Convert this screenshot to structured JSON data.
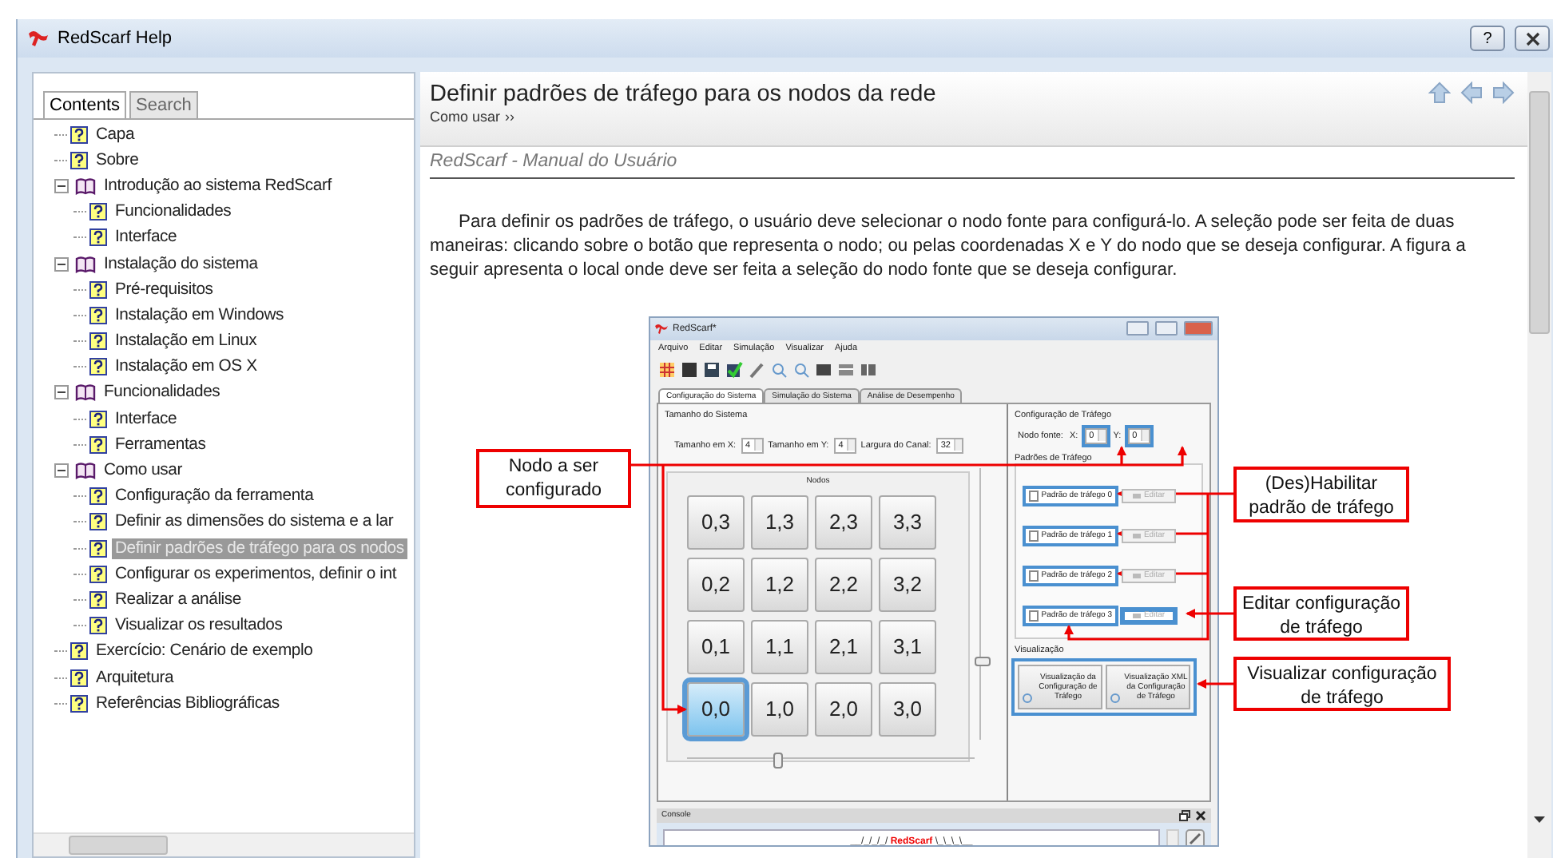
{
  "window": {
    "title": "RedScarf Help",
    "help_label": "?"
  },
  "nav_tabs": [
    {
      "label": "Contents",
      "selected": true
    },
    {
      "label": "Search",
      "selected": false
    }
  ],
  "tree": [
    {
      "label": "Capa",
      "kind": "page",
      "selected": false
    },
    {
      "label": "Sobre",
      "kind": "page",
      "selected": false
    },
    {
      "label": "Introdução ao sistema RedScarf",
      "kind": "book",
      "expanded": true,
      "selected": false,
      "children": [
        {
          "label": "Funcionalidades",
          "kind": "page",
          "selected": false
        },
        {
          "label": "Interface",
          "kind": "page",
          "selected": false
        }
      ]
    },
    {
      "label": "Instalação do sistema",
      "kind": "book",
      "expanded": true,
      "selected": false,
      "children": [
        {
          "label": "Pré-requisitos",
          "kind": "page",
          "selected": false
        },
        {
          "label": "Instalação em Windows",
          "kind": "page",
          "selected": false
        },
        {
          "label": "Instalação em Linux",
          "kind": "page",
          "selected": false
        },
        {
          "label": "Instalação em OS X",
          "kind": "page",
          "selected": false
        }
      ]
    },
    {
      "label": "Funcionalidades",
      "kind": "book",
      "expanded": true,
      "selected": false,
      "children": [
        {
          "label": "Interface",
          "kind": "page",
          "selected": false
        },
        {
          "label": "Ferramentas",
          "kind": "page",
          "selected": false
        }
      ]
    },
    {
      "label": "Como usar",
      "kind": "book",
      "expanded": true,
      "selected": false,
      "children": [
        {
          "label": "Configuração da ferramenta",
          "kind": "page",
          "selected": false
        },
        {
          "label": "Definir as dimensões do sistema e a lar",
          "kind": "page",
          "selected": false
        },
        {
          "label": "Definir padrões de tráfego para os nodos",
          "kind": "page",
          "selected": true
        },
        {
          "label": "Configurar os experimentos, definir o int",
          "kind": "page",
          "selected": false
        },
        {
          "label": "Realizar a análise",
          "kind": "page",
          "selected": false
        },
        {
          "label": "Visualizar os resultados",
          "kind": "page",
          "selected": false
        }
      ]
    },
    {
      "label": "Exercício: Cenário de exemplo",
      "kind": "page",
      "selected": false
    },
    {
      "label": "Arquitetura",
      "kind": "page",
      "selected": false
    },
    {
      "label": "Referências Bibliográficas",
      "kind": "page",
      "selected": false
    }
  ],
  "topic": {
    "title": "Definir padrões de tráfego para os nodos da rede",
    "breadcrumb": "Como usar",
    "breadcrumb_sep": "››"
  },
  "doc_header": "RedScarf - Manual do Usuário",
  "paragraph": "Para definir os padrões de tráfego, o usuário deve selecionar o nodo fonte para configurá-lo. A seleção pode ser feita de duas maneiras: clicando sobre o botão que representa o nodo; ou pelas coordenadas X e Y do nodo que se deseja configurar. A figura a seguir apresenta o local onde deve ser feita a seleção do nodo fonte que se deseja configurar.",
  "figure": {
    "window": {
      "title": "RedScarf*"
    },
    "menu": [
      "Arquivo",
      "Editar",
      "Simulação",
      "Visualizar",
      "Ajuda"
    ],
    "tabs": [
      {
        "label": "Configuração do Sistema",
        "selected": true
      },
      {
        "label": "Simulação do Sistema",
        "selected": false
      },
      {
        "label": "Análise de Desempenho",
        "selected": false
      }
    ],
    "size_group": {
      "title": "Tamanho do Sistema",
      "fields": [
        {
          "label": "Tamanho em X:",
          "value": "4"
        },
        {
          "label": "Tamanho em Y:",
          "value": "4"
        },
        {
          "label": "Largura do Canal:",
          "value": "32"
        }
      ]
    },
    "nodes": {
      "title": "Nodos",
      "rows": [
        [
          {
            "label": "0,3",
            "selected": false
          },
          {
            "label": "1,3",
            "selected": false
          },
          {
            "label": "2,3",
            "selected": false
          },
          {
            "label": "3,3",
            "selected": false
          }
        ],
        [
          {
            "label": "0,2",
            "selected": false
          },
          {
            "label": "1,2",
            "selected": false
          },
          {
            "label": "2,2",
            "selected": false
          },
          {
            "label": "3,2",
            "selected": false
          }
        ],
        [
          {
            "label": "0,1",
            "selected": false
          },
          {
            "label": "1,1",
            "selected": false
          },
          {
            "label": "2,1",
            "selected": false
          },
          {
            "label": "3,1",
            "selected": false
          }
        ],
        [
          {
            "label": "0,0",
            "selected": true
          },
          {
            "label": "1,0",
            "selected": false
          },
          {
            "label": "2,0",
            "selected": false
          },
          {
            "label": "3,0",
            "selected": false
          }
        ]
      ]
    },
    "sliders": {
      "vertical": {
        "level": 0.27
      },
      "horizontal": {
        "level": 0.3
      }
    },
    "traffic": {
      "title": "Configuração de Tráfego",
      "source_label": "Nodo fonte:",
      "coords": [
        {
          "label": "X:",
          "value": "0",
          "highlighted": true
        },
        {
          "label": "Y:",
          "value": "0",
          "highlighted": true
        }
      ]
    },
    "patterns": {
      "title": "Padrões de Tráfego",
      "items": [
        {
          "label": "Padrão de tráfego 0",
          "checked": false,
          "highlighted": true,
          "edit_label": "Editar",
          "edit_disabled": true,
          "edit_highlighted": false
        },
        {
          "label": "Padrão de tráfego 1",
          "checked": false,
          "highlighted": true,
          "edit_label": "Editar",
          "edit_disabled": true,
          "edit_highlighted": false
        },
        {
          "label": "Padrão de tráfego 2",
          "checked": false,
          "highlighted": true,
          "edit_label": "Editar",
          "edit_disabled": true,
          "edit_highlighted": false
        },
        {
          "label": "Padrão de tráfego 3",
          "checked": false,
          "highlighted": true,
          "edit_label": "Editar",
          "edit_disabled": true,
          "edit_highlighted": true
        }
      ]
    },
    "visualization": {
      "title": "Visualização",
      "highlighted": true,
      "buttons": [
        {
          "label": "Visualização da Configuração de Tráfego"
        },
        {
          "label": "Visualização XML da Configuração de Tráfego"
        }
      ]
    },
    "console": {
      "title": "Console",
      "banner_left": "__/_/_/_/",
      "banner_brand": "RedScarf",
      "banner_right": "\\_\\_\\_\\__"
    }
  },
  "callouts": [
    {
      "text": "Nodo a ser configurado"
    },
    {
      "text": "(Des)Habilitar padrão de tráfego"
    },
    {
      "text": "Editar configuração de tráfego"
    },
    {
      "text": "Visualizar configuração de tráfego"
    }
  ]
}
